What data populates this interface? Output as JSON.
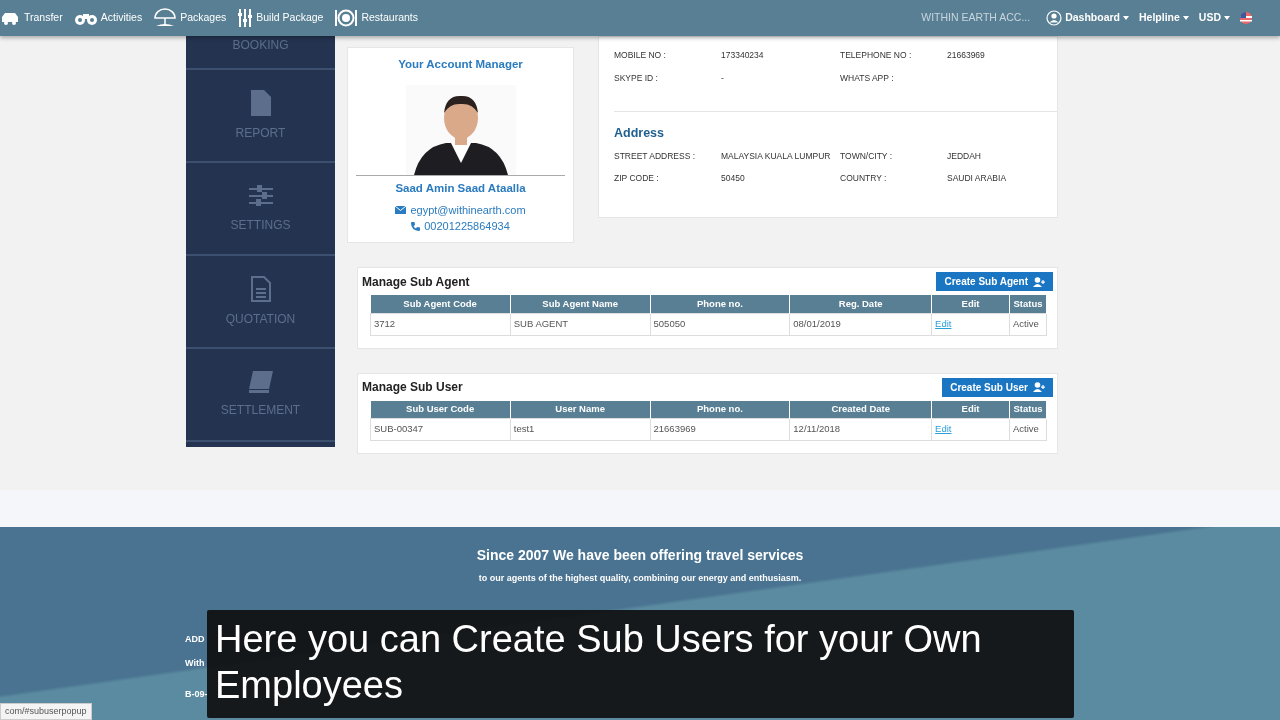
{
  "navbar": {
    "items": [
      {
        "label": "Transfer",
        "kind": "car"
      },
      {
        "label": "Activities",
        "kind": "binoculars"
      },
      {
        "label": "Packages",
        "kind": "umbrella"
      },
      {
        "label": "Build Package",
        "kind": "sliders"
      },
      {
        "label": "Restaurants",
        "kind": "plate"
      }
    ],
    "account": "WITHIN EARTH ACC...",
    "menus": [
      {
        "label": "Dashboard",
        "kind": "user"
      },
      {
        "label": "Helpline",
        "kind": "plain"
      },
      {
        "label": "USD",
        "kind": "plain"
      }
    ]
  },
  "sidebar": {
    "items": [
      {
        "label": "BOOKING",
        "kind": "none"
      },
      {
        "label": "REPORT",
        "kind": "file"
      },
      {
        "label": "SETTINGS",
        "kind": "sliders"
      },
      {
        "label": "QUOTATION",
        "kind": "doc"
      },
      {
        "label": "SETTLEMENT",
        "kind": "book"
      }
    ]
  },
  "account_manager": {
    "title": "Your Account Manager",
    "name": "Saad Amin Saad Ataalla",
    "email": "egypt@withinearth.com",
    "phone": "00201225864934"
  },
  "contact": {
    "fields": [
      {
        "label": "MOBILE NO :",
        "value": "173340234"
      },
      {
        "label": "TELEPHONE NO :",
        "value": "21663969"
      },
      {
        "label": "SKYPE ID :",
        "value": "-"
      },
      {
        "label": "WHATS APP :"
      }
    ]
  },
  "address": {
    "title": "Address",
    "left": [
      {
        "label": "STREET ADDRESS :",
        "value": "MALAYSIA KUALA LUMPUR"
      },
      {
        "label": "ZIP CODE :",
        "value": "50450"
      }
    ],
    "right": [
      {
        "label": "TOWN/CITY :",
        "value": "JEDDAH"
      },
      {
        "label": "COUNTRY :",
        "value": "SAUDI ARABIA"
      }
    ]
  },
  "tables": [
    {
      "title": "Manage Sub Agent",
      "button": "Create Sub Agent",
      "columns": [
        "Sub Agent Code",
        "Sub Agent Name",
        "Phone no.",
        "Reg. Date",
        "Edit",
        "Status"
      ],
      "rows": [
        {
          "cells": [
            "3712",
            "SUB AGENT",
            "505050",
            "08/01/2019"
          ],
          "edit": "Edit",
          "status": "Active"
        }
      ]
    },
    {
      "title": "Manage Sub User",
      "button": "Create Sub User",
      "columns": [
        "Sub User Code",
        "User Name",
        "Phone no.",
        "Created Date",
        "Edit",
        "Status"
      ],
      "rows": [
        {
          "cells": [
            "SUB-00347",
            "test1",
            "21663969",
            "12/11/2018"
          ],
          "edit": "Edit",
          "status": "Active"
        }
      ]
    }
  ],
  "footer": {
    "headline": "Since 2007 We have been offering travel services",
    "tagline": "to our agents of the highest quality, combining our energy and enthusiasm.",
    "fragments": [
      "ADD",
      "With",
      "B-09-"
    ]
  },
  "subtitle": "Here you can Create Sub Users for your Own Employees",
  "status_url": "com/#subuserpopup"
}
